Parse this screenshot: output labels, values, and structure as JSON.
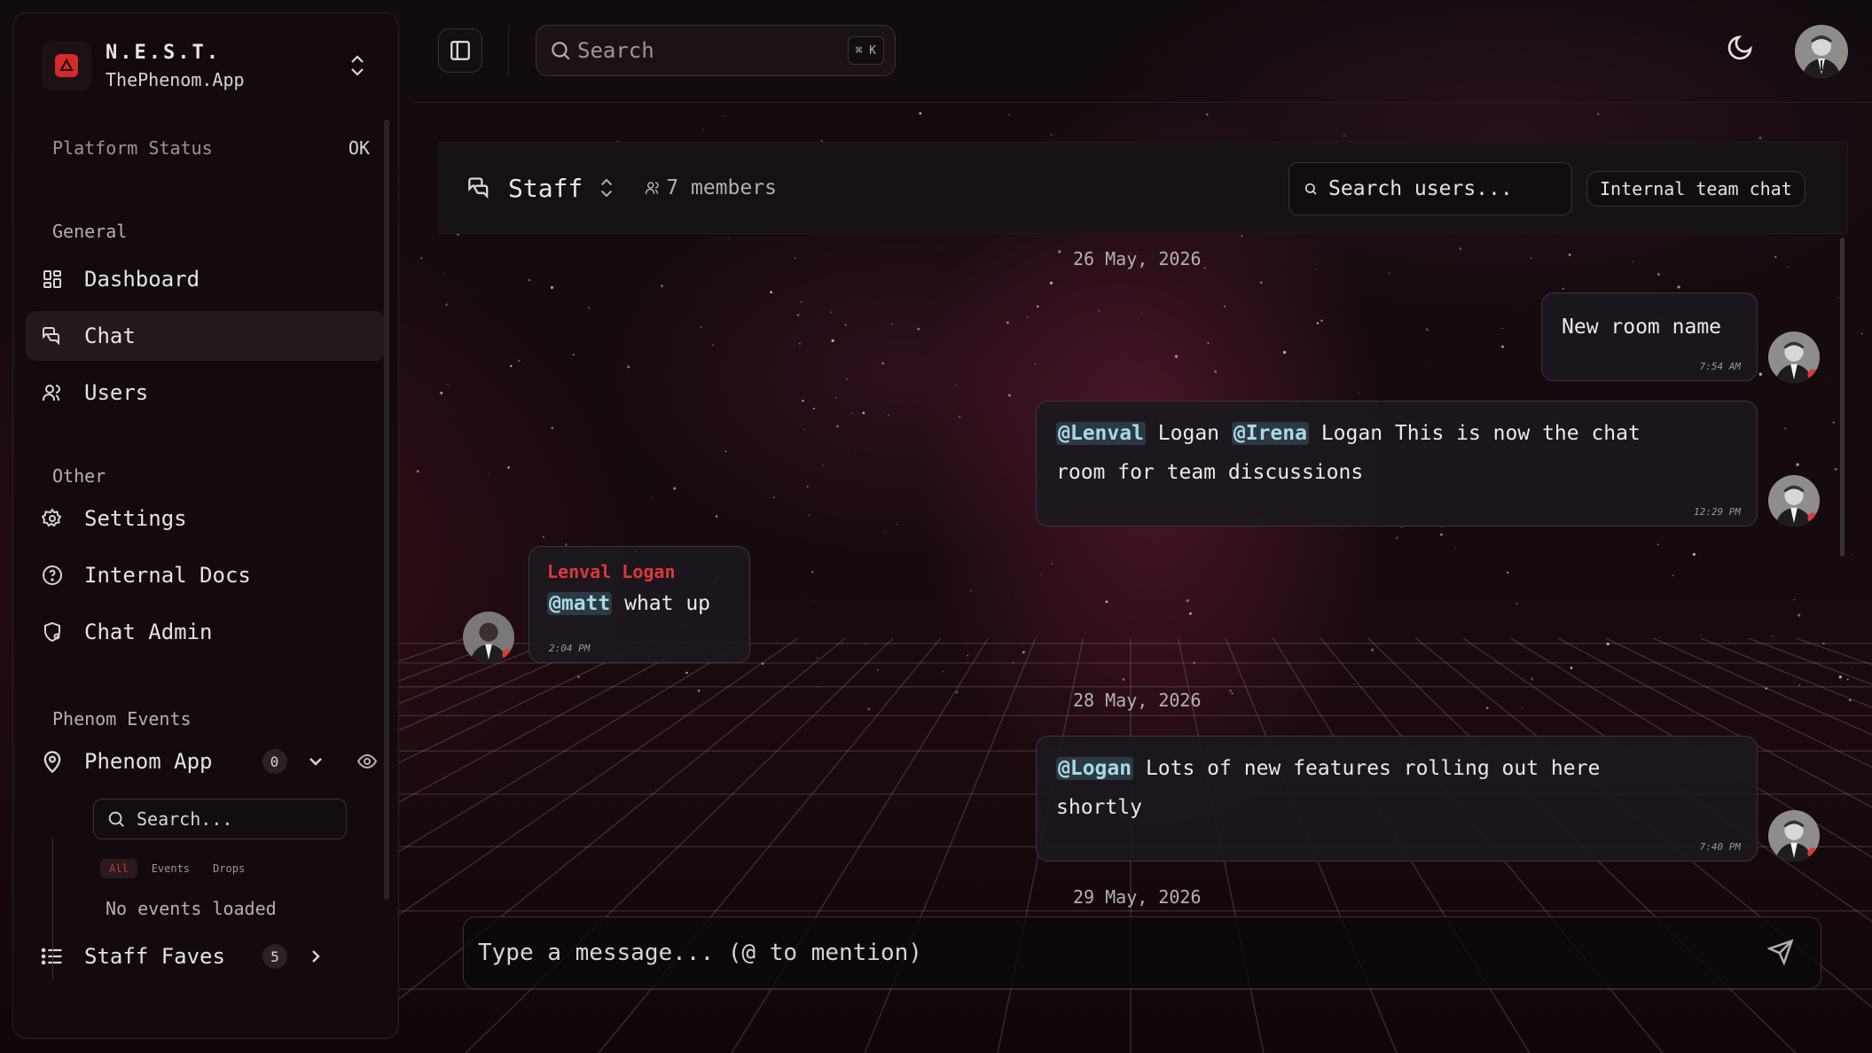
{
  "brand": {
    "title": "N.E.S.T.",
    "subtitle": "ThePhenom.App"
  },
  "status": {
    "label": "Platform Status",
    "value": "OK"
  },
  "nav": {
    "general_label": "General",
    "items": [
      {
        "label": "Dashboard",
        "icon": "dashboard-icon"
      },
      {
        "label": "Chat",
        "icon": "chat-icon",
        "active": true
      },
      {
        "label": "Users",
        "icon": "users-icon"
      }
    ],
    "other_label": "Other",
    "other_items": [
      {
        "label": "Settings",
        "icon": "gear-icon"
      },
      {
        "label": "Internal Docs",
        "icon": "help-circle-icon"
      },
      {
        "label": "Chat Admin",
        "icon": "shield-gear-icon"
      }
    ]
  },
  "events": {
    "section_label": "Phenom Events",
    "app_name": "Phenom App",
    "app_count": "0",
    "search_placeholder": "Search...",
    "filters": [
      "All",
      "Events",
      "Drops"
    ],
    "active_filter": "All",
    "empty_text": "No events loaded",
    "faves_label": "Staff Faves",
    "faves_count": "5"
  },
  "topbar": {
    "search_placeholder": "Search",
    "shortcut": "⌘ K"
  },
  "chat": {
    "room_name": "Staff",
    "members": "7 members",
    "user_search_placeholder": "Search users...",
    "description": "Internal team chat",
    "composer_placeholder": "Type a message... (@ to mention)",
    "dates": [
      "26 May, 2026",
      "28 May, 2026",
      "29 May, 2026"
    ],
    "messages": [
      {
        "text": "New room name",
        "time": "7:54 AM"
      },
      {
        "m1": "@Lenval",
        "t1": " Logan ",
        "m2": "@Irena",
        "t2": " Logan This is now the chat",
        "t3": "room for team discussions",
        "time": "12:29 PM"
      },
      {
        "sender": "Lenval Logan",
        "m1": "@matt",
        "t1": " what up",
        "time": "2:04 PM"
      },
      {
        "m1": "@Logan",
        "t1": " Lots of new features rolling out here",
        "t2": "shortly",
        "time": "7:40 PM"
      }
    ]
  },
  "colors": {
    "accent_red": "#d83a3a",
    "mention_bg": "#2b3a42",
    "mention_fg": "#a9d8e6"
  }
}
